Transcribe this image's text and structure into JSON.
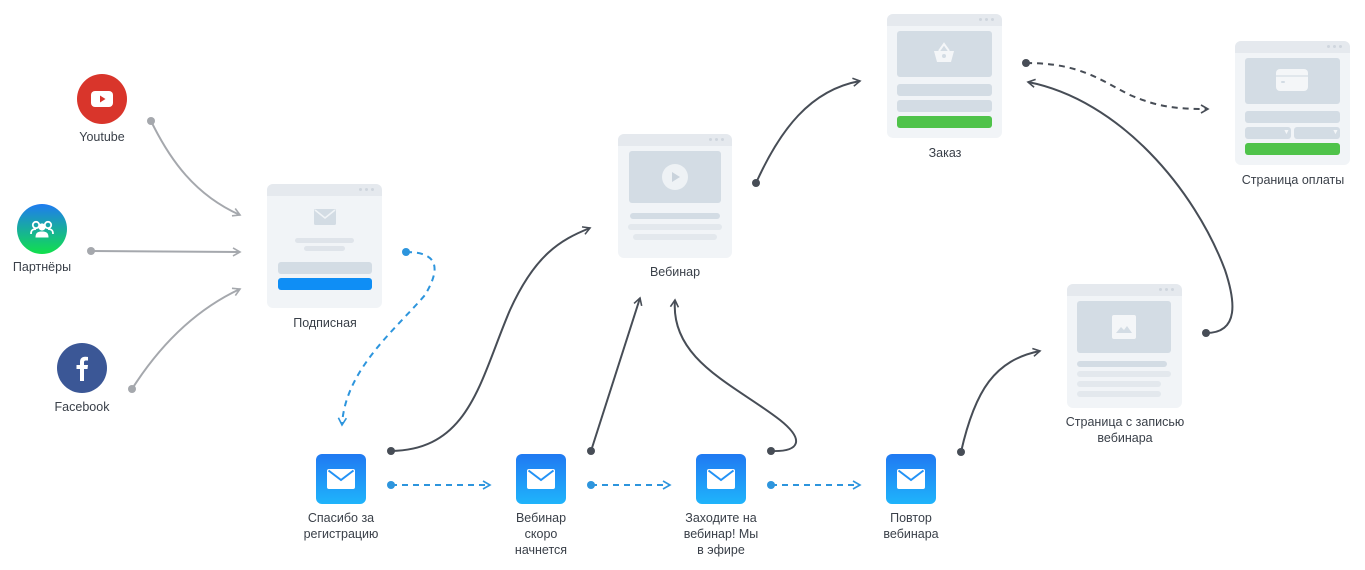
{
  "diagram": {
    "type": "marketing-funnel",
    "colors": {
      "youtube": "#d9352b",
      "partners_top": "#1f7bf0",
      "partners_bottom": "#11e04b",
      "facebook": "#3b5796",
      "email_top": "#2079f2",
      "email_bottom": "#1fb4fb",
      "page_bg": "#f1f4f7",
      "placeholder": "#d3dce4",
      "subscribe_button": "#0f8ef5",
      "buy_button": "#4fc34a",
      "solid_link": "#474d56",
      "source_link": "#a5a8ad",
      "email_link": "#2d95dd"
    },
    "sources": [
      {
        "id": "youtube",
        "label": "Youtube",
        "icon": "youtube-play-icon"
      },
      {
        "id": "partners",
        "label": "Партнёры",
        "icon": "users-group-icon"
      },
      {
        "id": "facebook",
        "label": "Facebook",
        "icon": "facebook-f-icon"
      }
    ],
    "pages": [
      {
        "id": "subscribe",
        "label": "Подписная",
        "icon": "envelope-icon"
      },
      {
        "id": "webinar",
        "label": "Вебинар",
        "icon": "play-icon"
      },
      {
        "id": "order",
        "label": "Заказ",
        "icon": "basket-icon"
      },
      {
        "id": "payment",
        "label": "Страница оплаты",
        "icon": "credit-card-icon"
      },
      {
        "id": "recording",
        "label": "Страница с записью\nвебинара",
        "label_line1": "Страница с записью",
        "label_line2": "вебинара",
        "icon": "image-icon"
      }
    ],
    "emails": [
      {
        "id": "thanks",
        "label_lines": [
          "Спасибо за",
          "регистрацию"
        ]
      },
      {
        "id": "soon",
        "label_lines": [
          "Вебинар",
          "скоро",
          "начнется"
        ]
      },
      {
        "id": "live",
        "label_lines": [
          "Заходите на",
          "вебинар! Мы",
          "в эфире"
        ]
      },
      {
        "id": "replay",
        "label_lines": [
          "Повтор",
          "вебинара"
        ]
      }
    ],
    "links": [
      {
        "from": "youtube",
        "to": "subscribe",
        "style": "solid-gray"
      },
      {
        "from": "partners",
        "to": "subscribe",
        "style": "solid-gray"
      },
      {
        "from": "facebook",
        "to": "subscribe",
        "style": "solid-gray"
      },
      {
        "from": "subscribe",
        "to": "thanks",
        "style": "dashed-blue"
      },
      {
        "from": "thanks",
        "to": "soon",
        "style": "dashed-blue"
      },
      {
        "from": "soon",
        "to": "live",
        "style": "dashed-blue"
      },
      {
        "from": "live",
        "to": "replay",
        "style": "dashed-blue"
      },
      {
        "from": "thanks",
        "to": "webinar",
        "style": "solid-dark"
      },
      {
        "from": "soon",
        "to": "webinar",
        "style": "solid-dark"
      },
      {
        "from": "live",
        "to": "webinar",
        "style": "solid-dark"
      },
      {
        "from": "webinar",
        "to": "order",
        "style": "solid-dark"
      },
      {
        "from": "order",
        "to": "payment",
        "style": "dashed-dark"
      },
      {
        "from": "recording",
        "to": "order",
        "style": "solid-dark"
      },
      {
        "from": "replay",
        "to": "recording",
        "style": "solid-dark"
      }
    ]
  }
}
